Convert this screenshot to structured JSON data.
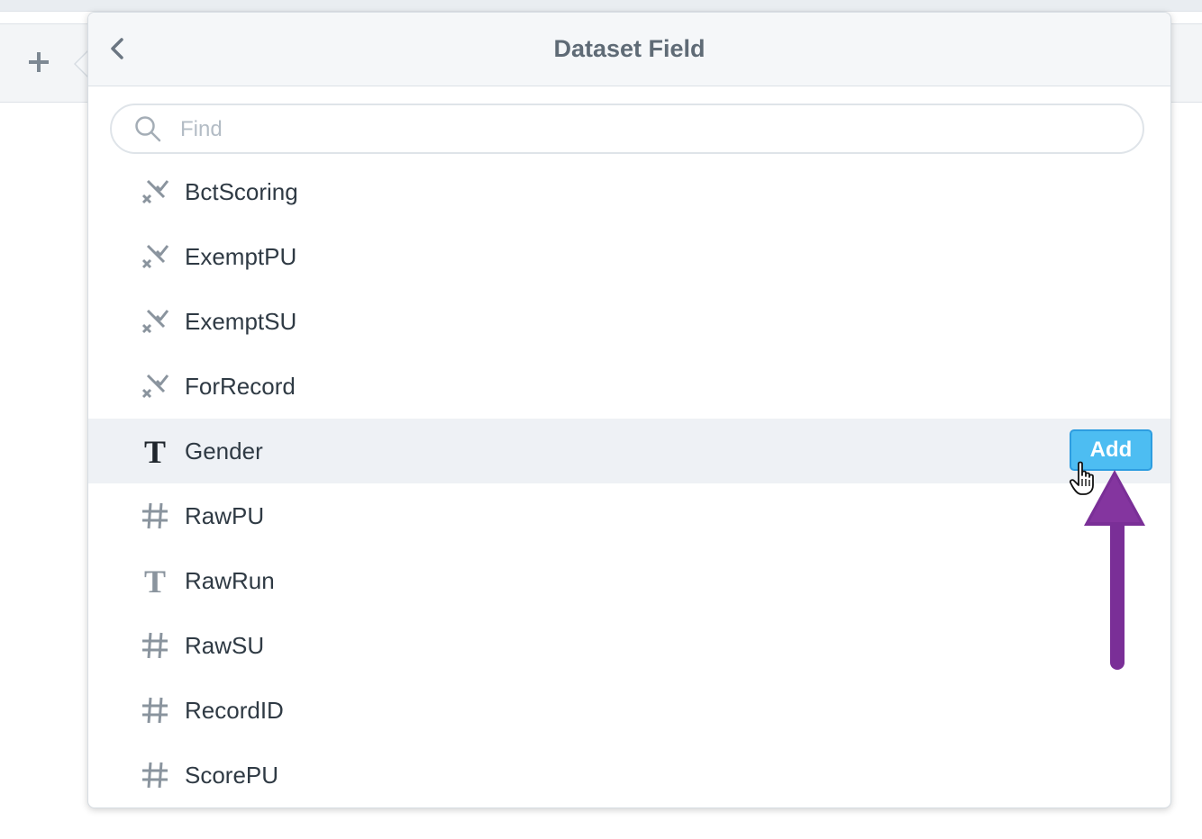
{
  "background": {
    "toolbar_add_icon": "plus-icon"
  },
  "popover": {
    "title": "Dataset Field",
    "back_icon": "chevron-left-icon",
    "search": {
      "placeholder": "Find",
      "value": "",
      "icon": "search-icon"
    },
    "fields": [
      {
        "label": "BctScoring",
        "type": "boolean",
        "icon": "boolean-icon"
      },
      {
        "label": "ExemptPU",
        "type": "boolean",
        "icon": "boolean-icon"
      },
      {
        "label": "ExemptSU",
        "type": "boolean",
        "icon": "boolean-icon"
      },
      {
        "label": "ForRecord",
        "type": "boolean",
        "icon": "boolean-icon"
      },
      {
        "label": "Gender",
        "type": "text",
        "icon": "text-type-icon",
        "hovered": true
      },
      {
        "label": "RawPU",
        "type": "number",
        "icon": "number-hash-icon"
      },
      {
        "label": "RawRun",
        "type": "text",
        "icon": "text-type-icon"
      },
      {
        "label": "RawSU",
        "type": "number",
        "icon": "number-hash-icon"
      },
      {
        "label": "RecordID",
        "type": "number",
        "icon": "number-hash-icon"
      },
      {
        "label": "ScorePU",
        "type": "number",
        "icon": "number-hash-icon"
      }
    ],
    "add_button_label": "Add"
  },
  "colors": {
    "accent_button": "#4dbdf2",
    "annotation_arrow": "#7a2f97",
    "hover_row": "#eef1f5",
    "title_text": "#5f6b76"
  }
}
